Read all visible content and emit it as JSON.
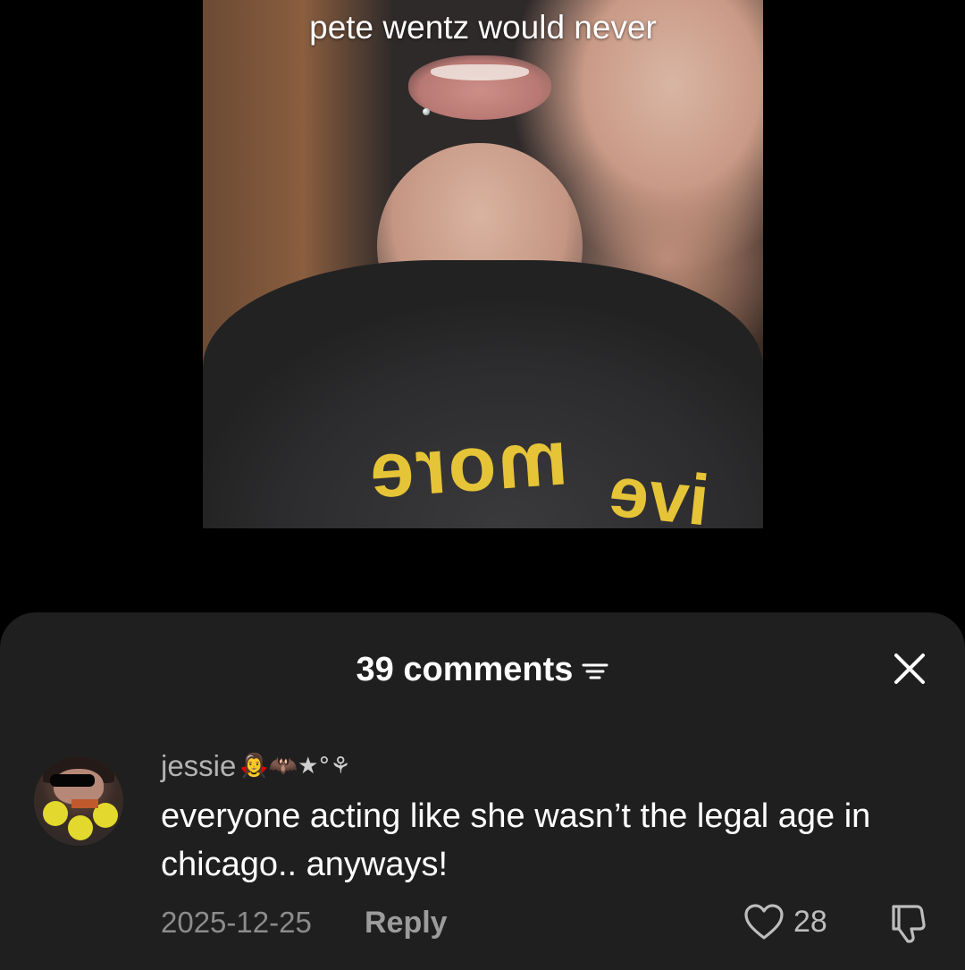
{
  "video": {
    "caption": "pete wentz would never",
    "shirt_print_left": "more",
    "shirt_print_right": "ive"
  },
  "comments_panel": {
    "count_label": "39 comments",
    "sort_icon": "filter-lines-icon",
    "close_icon": "close-icon"
  },
  "comment": {
    "username": "jessie",
    "username_emojis": "🧛‍♀️🦇★°⚘",
    "text": "everyone acting like she wasn’t the legal age in chicago.. anyways!",
    "date": "2025-12-25",
    "reply_label": "Reply",
    "like_count": "28",
    "like_icon": "heart-outline-icon",
    "dislike_icon": "thumbs-down-outline-icon"
  },
  "colors": {
    "background": "#000000",
    "sheet": "#1f1f1f",
    "muted_text": "#8c8c8c",
    "shirt_print": "#e6c437"
  }
}
